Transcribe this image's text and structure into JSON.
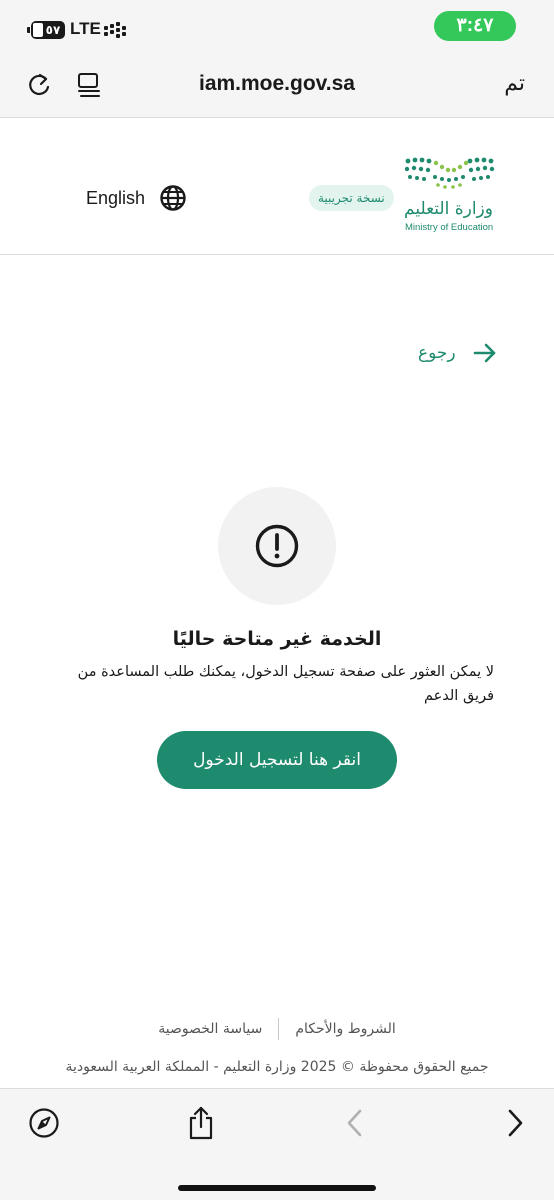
{
  "status_bar": {
    "battery_level": "٥٧",
    "network": "LTE",
    "time": "٣:٤٧"
  },
  "browser": {
    "url": "iam.moe.gov.sa",
    "done_label": "تم"
  },
  "header": {
    "logo_arabic": "وزارة التعليم",
    "logo_english": "Ministry of Education",
    "beta_badge": "نسخة تجريبية",
    "language_label": "English"
  },
  "main": {
    "back_label": "رجوع",
    "error_title": "الخدمة غير متاحة حاليًا",
    "error_message": "لا يمكن العثور على صفحة تسجيل الدخول، يمكنك طلب المساعدة من فريق الدعم",
    "login_button": "انقر هنا لتسجيل الدخول"
  },
  "footer": {
    "terms_link": "الشروط والأحكام",
    "privacy_link": "سياسة الخصوصية",
    "copyright": "جميع الحقوق محفوظة © 2025 وزارة التعليم - المملكة العربية السعودية"
  },
  "colors": {
    "brand_green": "#1e8a6e",
    "time_pill_green": "#34c759"
  }
}
